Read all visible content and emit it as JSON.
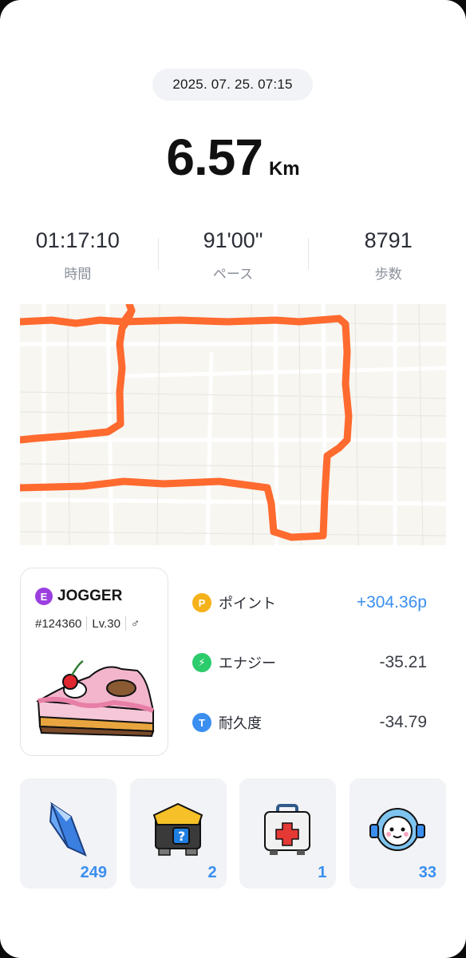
{
  "header": {
    "datetime": "2025. 07. 25. 07:15"
  },
  "distance": {
    "value": "6.57",
    "unit": "Km"
  },
  "stats": [
    {
      "value": "01:17:10",
      "label": "時間"
    },
    {
      "value": "91'00\"",
      "label": "ペース"
    },
    {
      "value": "8791",
      "label": "歩数"
    }
  ],
  "map": {
    "route_color": "#ff6a2f",
    "icon": "route-map"
  },
  "nft": {
    "badge": "E",
    "name": "JOGGER",
    "id": "#124360",
    "level": "Lv.30",
    "gender_symbol": "♂",
    "badge_color": "#9b3fe0",
    "icon": "cake-sneaker-image"
  },
  "rewards": [
    {
      "icon_letter": "P",
      "icon_color": "#f5b21b",
      "label": "ポイント",
      "value": "+304.36p"
    },
    {
      "icon_letter": "⚡",
      "icon_color": "#2ccb6b",
      "label": "エナジー",
      "value": "-35.21"
    },
    {
      "icon_letter": "T",
      "icon_color": "#3b8ff0",
      "label": "耐久度",
      "value": "-34.79"
    }
  ],
  "items": [
    {
      "name": "crystal-icon",
      "count": "249"
    },
    {
      "name": "mystery-box-icon",
      "count": "2"
    },
    {
      "name": "first-aid-kit-icon",
      "count": "1"
    },
    {
      "name": "robot-helmet-icon",
      "count": "33"
    }
  ],
  "colors": {
    "accent": "#3b8ff0",
    "route": "#ff6a2f"
  }
}
